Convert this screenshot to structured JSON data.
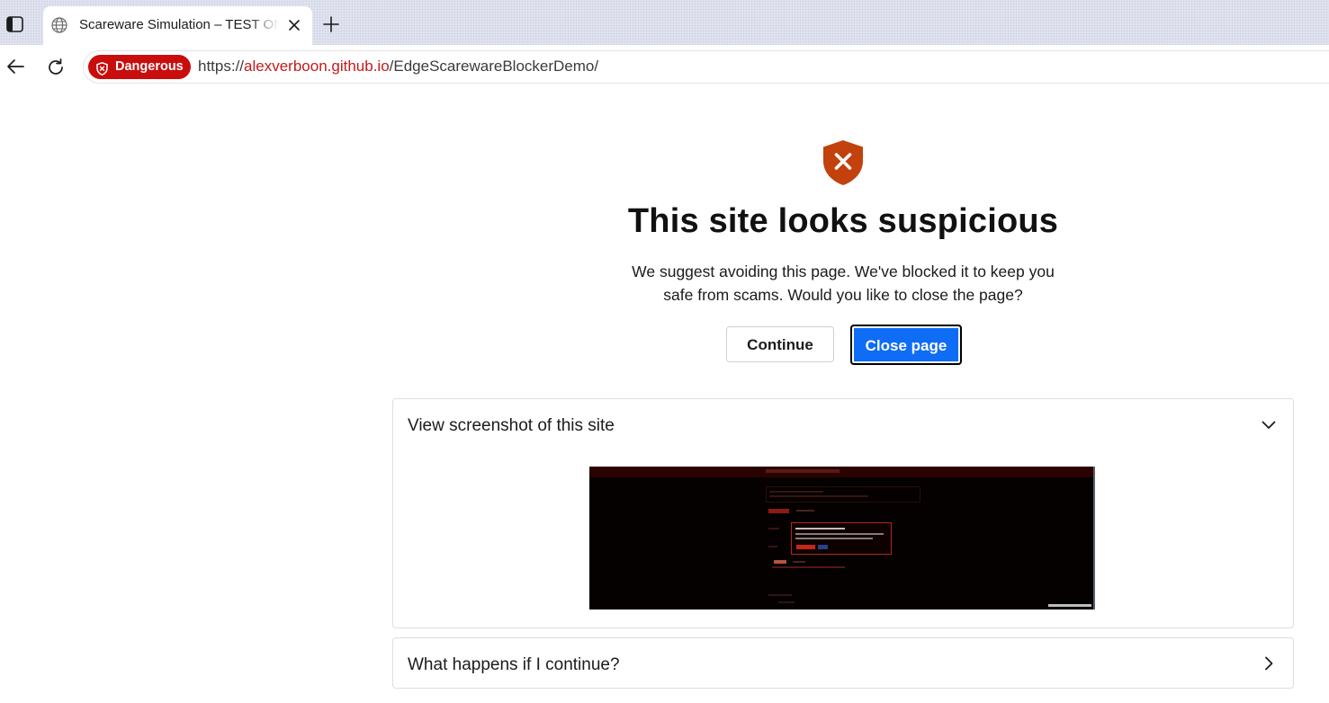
{
  "tab": {
    "title": "Scareware Simulation – TEST ONLY",
    "icon": "globe-icon"
  },
  "toolbar": {
    "security_badge": "Dangerous",
    "url_scheme": "https://",
    "url_host": "alexverboon.github.io",
    "url_path": "/EdgeScarewareBlockerDemo/"
  },
  "warning": {
    "icon": "shield-x-icon",
    "headline": "This site looks suspicious",
    "description": "We suggest avoiding this page. We've blocked it to keep you safe from scams. Would you like to close the page?",
    "continue_label": "Continue",
    "close_label": "Close page"
  },
  "panels": [
    {
      "title": "View screenshot of this site",
      "expanded": true
    },
    {
      "title": "What happens if I continue?",
      "expanded": false
    }
  ],
  "colors": {
    "danger": "#c90d0d",
    "primary": "#0f6cf5",
    "shield": "#c2410c"
  }
}
